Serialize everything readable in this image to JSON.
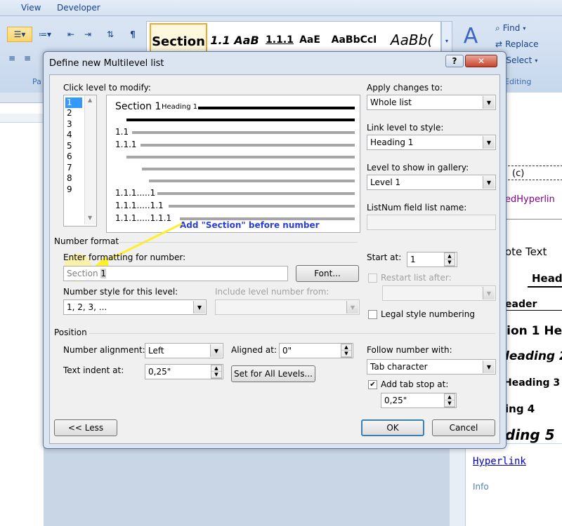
{
  "menu": {
    "view": "View",
    "developer": "Developer"
  },
  "ribbon": {
    "styles": [
      "Section",
      "1.1 AaB",
      "1.1.1",
      "AaE",
      "AaBbCcI",
      "AaBb("
    ],
    "find": "Find",
    "replace": "Replace",
    "select": "Select",
    "editing_group": "Editing",
    "paragraph_group": "Pa",
    "pilcrow": "¶"
  },
  "dialog": {
    "title": "Define new Multilevel list",
    "click_level_label": "Click level to modify:",
    "levels": [
      "1",
      "2",
      "3",
      "4",
      "5",
      "6",
      "7",
      "8",
      "9"
    ],
    "selected_level": "1",
    "preview": {
      "line1_number": "Section 1",
      "line1_heading": "Heading 1",
      "l2": "1.1",
      "l3": "1.1.1",
      "l7": "1.1.1.....1",
      "l8": "1.1.1.....1.1",
      "l9": "1.1.1.....1.1.1"
    },
    "annotation": "Add \"Section\" before number",
    "number_format_group": "Number format",
    "enter_formatting_label": "Enter formatting for number:",
    "format_prefix": "Section",
    "format_number": "1",
    "font_button": "Font...",
    "number_style_label": "Number style for this level:",
    "number_style_value": "1, 2, 3, ...",
    "include_level_label": "Include level number from:",
    "include_level_value": "",
    "apply_changes_label": "Apply changes to:",
    "apply_changes_value": "Whole list",
    "link_level_label": "Link level to style:",
    "link_level_value": "Heading 1",
    "gallery_level_label": "Level to show in gallery:",
    "gallery_level_value": "Level 1",
    "listnum_label": "ListNum field list name:",
    "listnum_value": "",
    "start_at_label": "Start at:",
    "start_at_value": "1",
    "restart_label": "Restart list after:",
    "restart_value": "",
    "legal_label": "Legal style numbering",
    "legal_checked": false,
    "position_group": "Position",
    "alignment_label": "Number alignment:",
    "alignment_value": "Left",
    "aligned_at_label": "Aligned at:",
    "aligned_at_value": "0\"",
    "indent_label": "Text indent at:",
    "indent_value": "0,25\"",
    "set_all_button": "Set for All Levels...",
    "follow_label": "Follow number with:",
    "follow_value": "Tab character",
    "tabstop_label": "Add tab stop at:",
    "tabstop_checked": true,
    "tabstop_value": "0,25\"",
    "less_button": "<< Less",
    "ok_button": "OK",
    "cancel_button": "Cancel",
    "help": "?",
    "close": "✕"
  },
  "pane": {
    "c": "(c)",
    "followed_hyperlink": "edHyperlin",
    "footnote_text": "ote Text",
    "header_1": "Head",
    "header_2": "eader",
    "heading1": "tion 1  Hea",
    "heading2": "leading 2",
    "heading3": "Heading 3",
    "heading4": "ing 4",
    "heading5": "ding 5",
    "hyperlink": "Hyperlink",
    "info": "Info"
  }
}
